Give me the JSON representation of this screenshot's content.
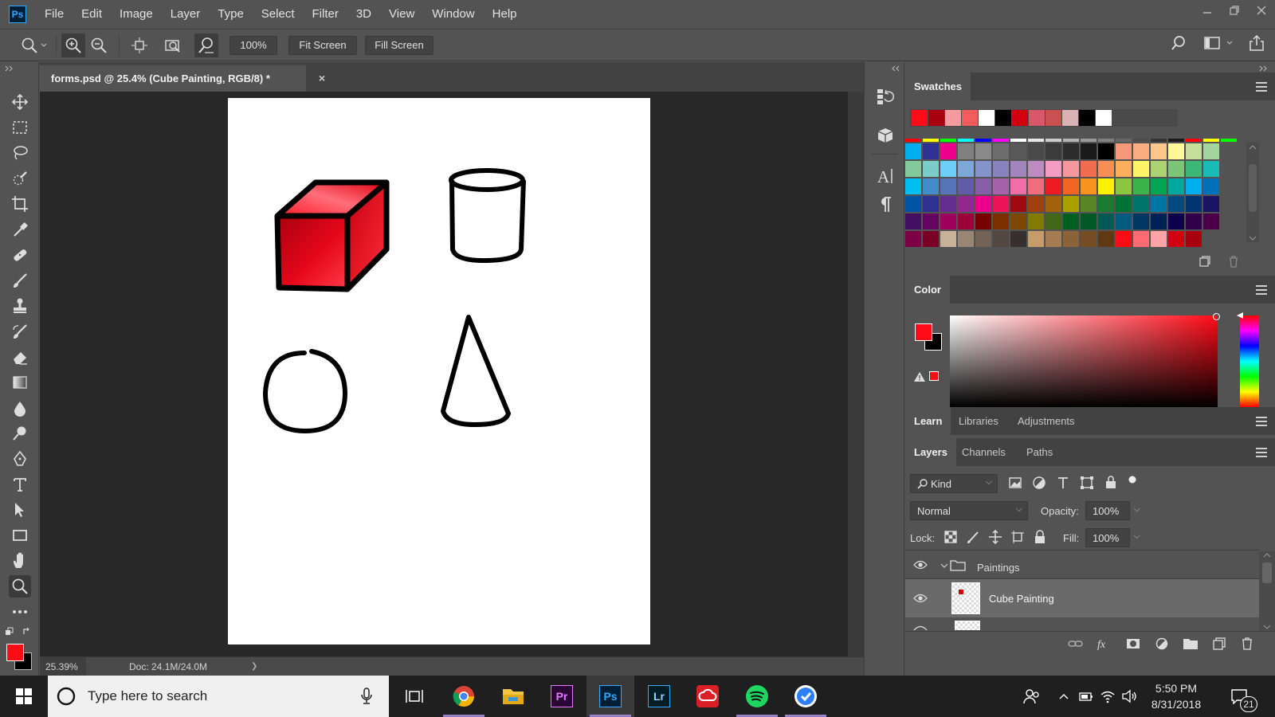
{
  "app": {
    "logo": "Ps"
  },
  "menu": [
    "File",
    "Edit",
    "Image",
    "Layer",
    "Type",
    "Select",
    "Filter",
    "3D",
    "View",
    "Window",
    "Help"
  ],
  "options_bar": {
    "zoom_value": "100%",
    "fit_screen": "Fit Screen",
    "fill_screen": "Fill Screen"
  },
  "document": {
    "tab_title": "forms.psd @ 25.4% (Cube Painting, RGB/8) *",
    "close_glyph": "×"
  },
  "status": {
    "zoom": "25.39%",
    "doc_size": "Doc: 24.1M/24.0M",
    "arrow": "❯"
  },
  "tools": [
    "move",
    "marquee",
    "lasso",
    "quick-selection",
    "crop",
    "eyedropper",
    "healing",
    "brush",
    "clone-stamp",
    "history-brush",
    "eraser",
    "gradient",
    "blur",
    "dodge",
    "pen",
    "type",
    "path-selection",
    "rectangle",
    "hand",
    "zoom",
    "more"
  ],
  "colors": {
    "foreground": "#ff0a17",
    "background": "#000000",
    "accent": "#31a8ff"
  },
  "swatches_panel": {
    "title": "Swatches",
    "recent": [
      "#ff0a17",
      "#a8000f",
      "#f79aa0",
      "#f25c5c",
      "#ffffff",
      "#000000",
      "#d1000f",
      "#d9566b",
      "#c94f50",
      "#d9b0b4",
      "#000000",
      "#ffffff"
    ],
    "grid": [
      [
        "#00aeef",
        "#2e3192",
        "#ec008c",
        "#808080",
        "#898989",
        "#6d6d6d",
        "#595959",
        "#4a4a4a",
        "#3b3b3b",
        "#2c2c2c",
        "#1a1a1a",
        "#000000",
        "#f7977a",
        "#fbad82",
        "#fdc68c",
        "#fff799",
        "#c6df9c",
        "#a4d49d"
      ],
      [
        "#82ca9c",
        "#7accc8",
        "#6dcff6",
        "#7da7d9",
        "#8493ca",
        "#8882be",
        "#a186be",
        "#bc8cbf",
        "#f49bc1",
        "#f5989d",
        "#f26c4f",
        "#f68e56",
        "#fbaf5c",
        "#fff467",
        "#acd372",
        "#7cc576",
        "#3bb878",
        "#1abbb4"
      ],
      [
        "#00bff3",
        "#438ccb",
        "#5574b9",
        "#605ca8",
        "#855fa8",
        "#a763a9",
        "#ef6ea8",
        "#f16d7e",
        "#ed1c24",
        "#f26522",
        "#f7941d",
        "#fff200",
        "#8dc63f",
        "#39b54a",
        "#00a651",
        "#00a99d",
        "#00aeef",
        "#0072bc"
      ],
      [
        "#0054a6",
        "#2e3192",
        "#662d91",
        "#92278f",
        "#ec008c",
        "#ed145b",
        "#9e0b0f",
        "#a0410d",
        "#a3620a",
        "#aba000",
        "#598527",
        "#1a7b30",
        "#007236",
        "#00746b",
        "#0076a3",
        "#004a80",
        "#003471",
        "#1b1464"
      ],
      [
        "#440e62",
        "#630460",
        "#9e005d",
        "#9e0039",
        "#790000",
        "#7b2e00",
        "#7d4900",
        "#827b00",
        "#406618",
        "#005e20",
        "#005826",
        "#005952",
        "#005b7f",
        "#003663",
        "#002157",
        "#0d004c",
        "#32004b",
        "#4b0049"
      ],
      [
        "#7b0046",
        "#7a0026",
        "#c7b299",
        "#998675",
        "#736357",
        "#534741",
        "#362f2d",
        "#c69c6d",
        "#a67c52",
        "#8c6239",
        "#754c24",
        "#603913",
        "#ff0a17",
        "#ff6b72",
        "#ffa3a8",
        "#d1000f",
        "#a8000f"
      ]
    ]
  },
  "color_panel": {
    "title": "Color"
  },
  "learn_tabs": [
    "Learn",
    "Libraries",
    "Adjustments"
  ],
  "layers_panel": {
    "tabs": [
      "Layers",
      "Channels",
      "Paths"
    ],
    "filter": "Kind",
    "blend_mode": "Normal",
    "opacity_label": "Opacity:",
    "opacity": "100%",
    "lock_label": "Lock:",
    "fill_label": "Fill:",
    "fill": "100%",
    "group_name": "Paintings",
    "layers": [
      "Cube Painting"
    ]
  },
  "taskbar": {
    "search_placeholder": "Type here to search",
    "time": "5:50 PM",
    "date": "8/31/2018",
    "notifications": "21",
    "apps": [
      "task-view",
      "chrome",
      "file-explorer",
      "premiere",
      "photoshop",
      "lightroom",
      "creative-cloud",
      "spotify",
      "blue-app"
    ],
    "app_labels": {
      "premiere": "Pr",
      "photoshop": "Ps",
      "lightroom": "Lr"
    }
  }
}
